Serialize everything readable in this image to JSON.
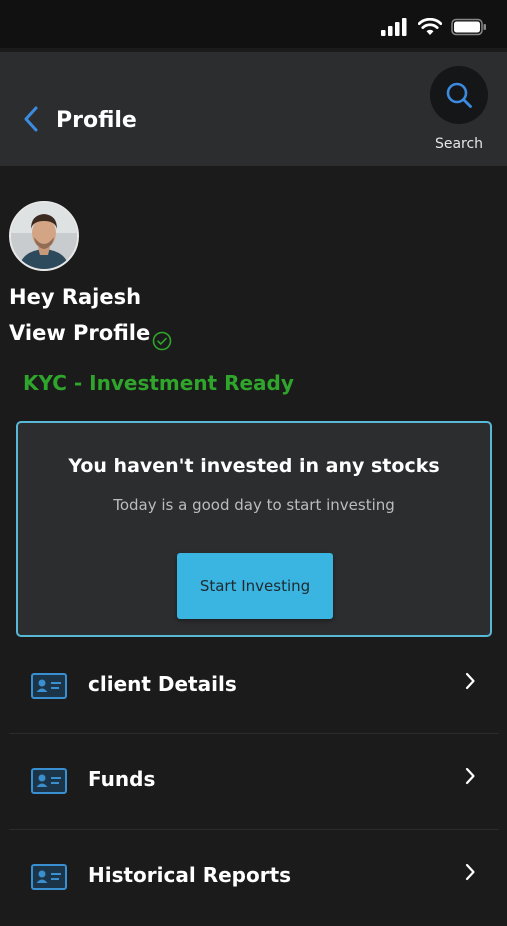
{
  "header": {
    "title": "Profile",
    "search_label": "Search"
  },
  "profile": {
    "greeting": "Hey Rajesh",
    "view_profile": "View Profile",
    "kyc_status": "KYC - Investment Ready"
  },
  "invest_card": {
    "title": "You haven't invested in any stocks",
    "subtitle": "Today is a good day to start investing",
    "button_label": "Start Investing"
  },
  "menu": {
    "items": [
      {
        "label": "client Details",
        "icon": "id-card-icon"
      },
      {
        "label": "Funds",
        "icon": "id-card-icon"
      },
      {
        "label": "Historical Reports",
        "icon": "id-card-icon"
      }
    ]
  },
  "colors": {
    "accent": "#3ab4e0",
    "kyc_green": "#2fa52b",
    "back_blue": "#3b8be0",
    "background": "#1b1b1c",
    "header_bg": "#2c2d2f"
  }
}
